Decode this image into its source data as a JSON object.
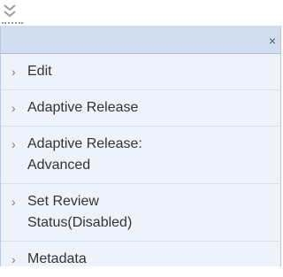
{
  "toggle": {
    "icon": "double-chevron-down-icon"
  },
  "menu": {
    "close_label": "×",
    "items": [
      {
        "label": "Edit",
        "icon": "chevron-right-icon"
      },
      {
        "label": "Adaptive Release",
        "icon": "chevron-right-icon"
      },
      {
        "label": "Adaptive Release:\nAdvanced",
        "icon": "chevron-right-icon"
      },
      {
        "label": "Set Review\nStatus(Disabled)",
        "icon": "chevron-right-icon"
      },
      {
        "label": "Metadata",
        "icon": "chevron-right-icon"
      }
    ]
  },
  "colors": {
    "panel_bg": "#eef3fb",
    "header_bg": "#d2deef",
    "text": "#333333"
  }
}
